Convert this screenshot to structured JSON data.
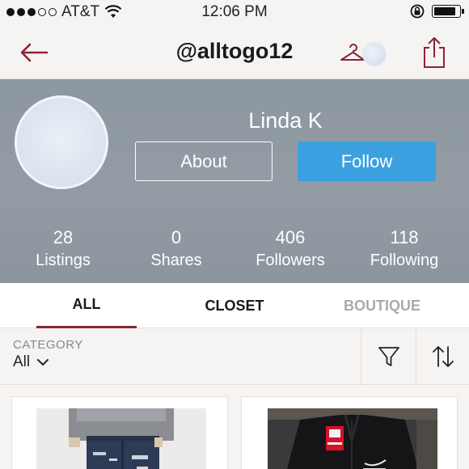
{
  "status_bar": {
    "carrier": "AT&T",
    "time": "12:06 PM",
    "signal_bars_filled": 3,
    "signal_bars_total": 5,
    "battery_level": 0.85
  },
  "nav": {
    "title": "@alltogo12",
    "back_icon": "back-arrow-icon",
    "hanger_icon": "hanger-icon",
    "share_icon": "share-icon",
    "accent_color": "#8b2334"
  },
  "profile": {
    "name": "Linda K",
    "about_label": "About",
    "follow_label": "Follow",
    "follow_color": "#3aa0e0",
    "stats": [
      {
        "value": "28",
        "label": "Listings"
      },
      {
        "value": "0",
        "label": "Shares"
      },
      {
        "value": "406",
        "label": "Followers"
      },
      {
        "value": "118",
        "label": "Following"
      }
    ]
  },
  "tabs": [
    {
      "label": "ALL",
      "active": true
    },
    {
      "label": "CLOSET",
      "active": false
    },
    {
      "label": "BOUTIQUE",
      "active": false
    }
  ],
  "filter": {
    "category_label": "CATEGORY",
    "category_value": "All",
    "filter_icon": "funnel-icon",
    "sort_icon": "sort-arrows-icon"
  },
  "listings": [
    {
      "image": "distressed-jeans-photo"
    },
    {
      "image": "black-nike-jacket-photo"
    }
  ]
}
